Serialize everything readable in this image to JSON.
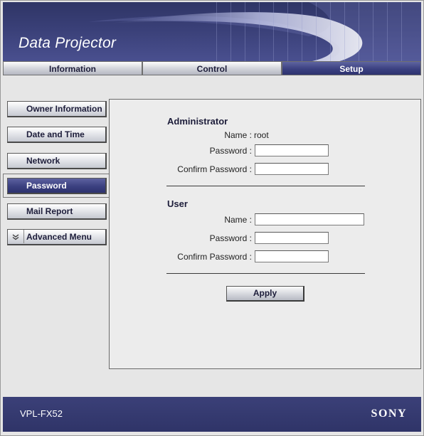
{
  "header": {
    "title": "Data Projector"
  },
  "tabs": [
    {
      "label": "Information",
      "active": false
    },
    {
      "label": "Control",
      "active": false
    },
    {
      "label": "Setup",
      "active": true
    }
  ],
  "menu": {
    "items": [
      {
        "label": "Owner Information"
      },
      {
        "label": "Date and Time"
      },
      {
        "label": "Network"
      },
      {
        "label": "Password",
        "active": true
      },
      {
        "label": "Mail Report"
      },
      {
        "label": "Advanced Menu",
        "icon": "collapse-arrows-icon"
      }
    ]
  },
  "administrator": {
    "heading": "Administrator",
    "name_label": "Name :",
    "name_value": "root",
    "password_label": "Password :",
    "password_value": "",
    "confirm_label": "Confirm Password :",
    "confirm_value": ""
  },
  "user": {
    "heading": "User",
    "name_label": "Name :",
    "name_value": "",
    "password_label": "Password :",
    "password_value": "",
    "confirm_label": "Confirm Password :",
    "confirm_value": ""
  },
  "apply_label": "Apply",
  "footer": {
    "model": "VPL-FX52",
    "brand": "SONY"
  },
  "colors": {
    "accent": "#3b4080",
    "panel": "#ececec",
    "background": "#e6e6e6"
  }
}
